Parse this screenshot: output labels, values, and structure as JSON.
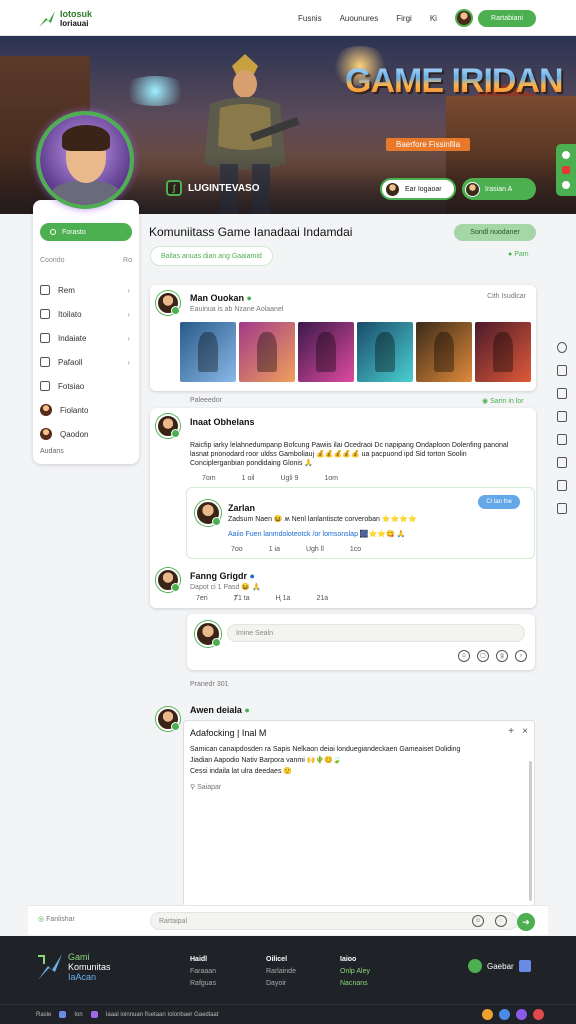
{
  "nav": {
    "logo_line1": "Iotosuk",
    "logo_line2": "Ioriauai",
    "links": [
      "Fusnis",
      "Auounures",
      "Firgi",
      "Ki"
    ],
    "cta": "Rartabiani"
  },
  "hero": {
    "title": "GAME IRIDAN",
    "subtitle": "Baerfore Fissinfila",
    "username": "LUGINTEVASO",
    "pill_primary": "Ear Iogaoar",
    "pill_secondary": "Irasian A"
  },
  "sidebar": {
    "follow": "Forasto",
    "row_left": "Coorido",
    "row_right": "Ro",
    "menu": [
      "Rem",
      "Itoilato",
      "Indaiate",
      "Pafaoll",
      "Fotsiao",
      "Fiolanto",
      "Qaodon"
    ],
    "footer": "Audans"
  },
  "main": {
    "title": "Komuniitass Game Ianadaai Indamdai",
    "pill": "Sondl nuodaner",
    "subtitle": "Bailas anuas dian ang Gaaiamid",
    "live": "Pam"
  },
  "post1": {
    "name": "Man Ouokan",
    "meta": "Eauinua is ab Nzane Aolaanel",
    "meta_right": "Cith Isudlcar",
    "below_left": "Paleeedor",
    "below_right": "Sarin in lor"
  },
  "post2": {
    "name": "Inaat Obhelans",
    "body": "Raicfip iarky lelahnedumpanp Bofcung Pawiis ilai Ocedraoi Dc napipang Ondaploon Dolenfing panonal lasnat pnonodard roor uldss Gamboliauj 💰💰💰💰💰 ua pacpuond ipd Sid torton Soolin Conciplerganbian pondidaing Glonis 🙏",
    "stats": [
      "7om",
      "1 oil",
      "Ugli 9",
      "1om"
    ]
  },
  "reply": {
    "name": "Zarlan",
    "line1": "Zadsum Naen 😆 ʍ Nenl lanlantiscte corveroban ⭐⭐⭐⭐",
    "line2": "Aaiio Fuen lanmdoloteotck /or lomsonslap 🎆⭐⭐😋 🙏",
    "tag": "Cl tan fne",
    "stats": [
      "7oo",
      "1 ia",
      "Ugh ll",
      "1co"
    ]
  },
  "post3": {
    "name": "Fanng Grigdr",
    "meta": "Dapot ci 1 Pasd 😆 🙏",
    "stats": [
      "7eri",
      "Ⱦ1 ta",
      "Ⱨ 1a",
      "21a"
    ]
  },
  "composer": {
    "placeholder": "Imine Sealn"
  },
  "post4": {
    "header": "Pranedr 301",
    "name": "Awen deiala",
    "editor_title": "Adafocking | Inal M",
    "body_line1": "Samican canaipdosden ra Sapis Nelkaon deiai londuegiandeckaen Gameaiset Doliding",
    "body_line2": "Jiadian Aapodio Nativ Barpora vanmi 🙌🌵😊🍃",
    "body_line3": "Cessi indaila lat ulra deedaes 🙂",
    "attach": "Saiapar"
  },
  "bottombar": {
    "left": "Fanlishar",
    "placeholder": "Rartaipal"
  },
  "footer": {
    "brand1": "Gami",
    "brand2": "Komunitas",
    "brand3": "IaAcan",
    "col1": {
      "h": "Haidl",
      "l1": "Faraaan",
      "l2": "Rafguas"
    },
    "col2": {
      "h": "Oilicel",
      "l1": "Rarlainde",
      "l2": "Dayoir"
    },
    "col3": {
      "h": "Iaioo",
      "l1": "Onlp Aley",
      "l2": "Nacnans"
    },
    "cta": "Gaebar",
    "bottom1": "Rasle",
    "bottom2": "Ion",
    "bottom3": "Iaaal ioinnuan fisetaan Iolonbaer Gaedlaat"
  },
  "colors": {
    "accent": "#4caf50",
    "footer_bg": "#1f2227"
  }
}
